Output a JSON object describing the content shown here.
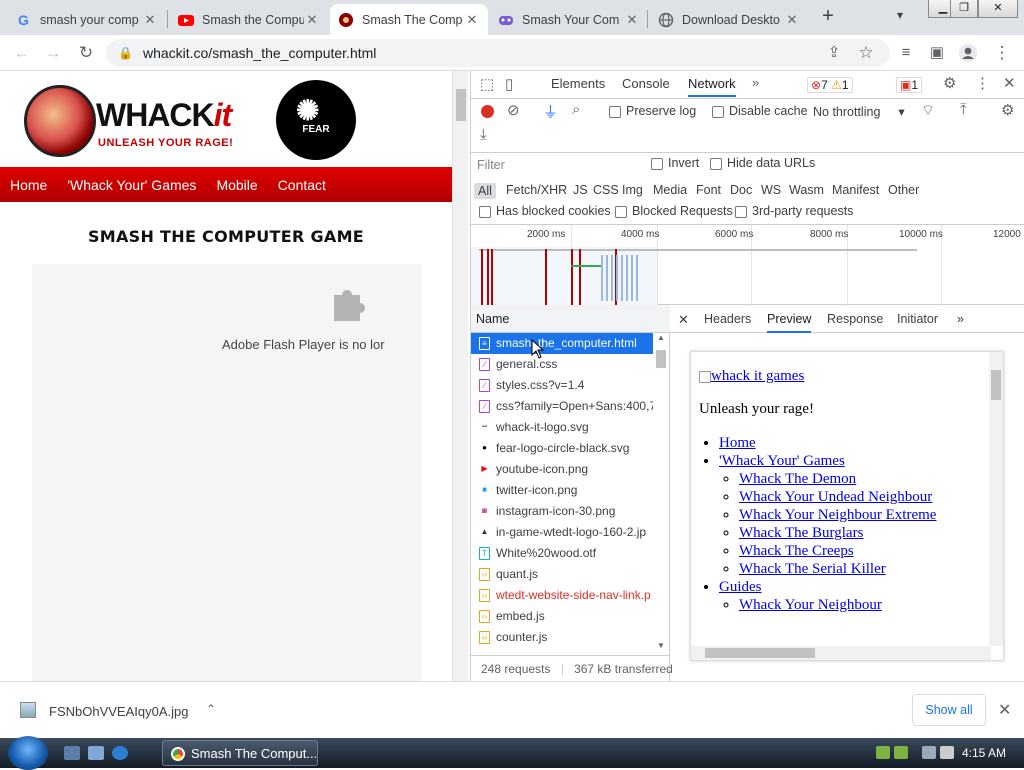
{
  "tabs": [
    {
      "title": "smash your comp",
      "icon": "google-icon",
      "active": false
    },
    {
      "title": "Smash the Compu",
      "icon": "youtube-icon",
      "active": false
    },
    {
      "title": "Smash The Comp",
      "icon": "whackit-icon",
      "active": true
    },
    {
      "title": "Smash Your Com",
      "icon": "gamepad-icon",
      "active": false
    },
    {
      "title": "Download Deskto",
      "icon": "globe-icon",
      "active": false
    }
  ],
  "omnibox": {
    "url": "whackit.co/smash_the_computer.html"
  },
  "site": {
    "logo_word": "WHACK",
    "logo_it": "it",
    "tagline": "UNLEASH YOUR RAGE!",
    "fear_label": "FEAR",
    "nav": [
      "Home",
      "'Whack Your' Games",
      "Mobile",
      "Contact"
    ],
    "game_title": "SMASH THE COMPUTER GAME",
    "flash_message": "Adobe Flash Player is no lor"
  },
  "devtools": {
    "tabs": [
      "Elements",
      "Console",
      "Network"
    ],
    "active_tab": "Network",
    "errors": "7",
    "warnings": "1",
    "issues": "1",
    "preserve_log": "Preserve log",
    "disable_cache": "Disable cache",
    "throttling": "No throttling",
    "filter_placeholder": "Filter",
    "invert": "Invert",
    "hide_data_urls": "Hide data URLs",
    "types": [
      "All",
      "Fetch/XHR",
      "JS",
      "CSS",
      "Img",
      "Media",
      "Font",
      "Doc",
      "WS",
      "Wasm",
      "Manifest",
      "Other"
    ],
    "has_blocked_cookies": "Has blocked cookies",
    "blocked_requests": "Blocked Requests",
    "third_party": "3rd-party requests",
    "timeline_ticks": [
      "2000 ms",
      "4000 ms",
      "6000 ms",
      "8000 ms",
      "10000 ms",
      "12000"
    ],
    "name_header": "Name",
    "requests": [
      {
        "name": "smash_the_computer.html",
        "kind": "doc",
        "selected": true
      },
      {
        "name": "general.css",
        "kind": "css"
      },
      {
        "name": "styles.css?v=1.4",
        "kind": "css"
      },
      {
        "name": "css?family=Open+Sans:400,70",
        "kind": "css"
      },
      {
        "name": "whack-it-logo.svg",
        "kind": "img"
      },
      {
        "name": "fear-logo-circle-black.svg",
        "kind": "img"
      },
      {
        "name": "youtube-icon.png",
        "kind": "img"
      },
      {
        "name": "twitter-icon.png",
        "kind": "img"
      },
      {
        "name": "instagram-icon-30.png",
        "kind": "img"
      },
      {
        "name": "in-game-wtedt-logo-160-2.jp",
        "kind": "img"
      },
      {
        "name": "White%20wood.otf",
        "kind": "font"
      },
      {
        "name": "quant.js",
        "kind": "js"
      },
      {
        "name": "wtedt-website-side-nav-link.p",
        "kind": "img",
        "error": true
      },
      {
        "name": "embed.js",
        "kind": "js"
      },
      {
        "name": "counter.js",
        "kind": "js"
      }
    ],
    "summary_requests": "248 requests",
    "summary_transferred": "367 kB transferred",
    "preview_tabs": [
      "Headers",
      "Preview",
      "Response",
      "Initiator"
    ],
    "preview_active": "Preview",
    "preview": {
      "img_alt": "whack it games",
      "tagline": "Unleash your rage!",
      "home": "Home",
      "games": "'Whack Your' Games",
      "games_sub": [
        "Whack The Demon",
        "Whack Your Undead Neighbour",
        "Whack Your Neighbour Extreme",
        "Whack The Burglars",
        "Whack The Creeps",
        "Whack The Serial Killer"
      ],
      "guides": "Guides",
      "guides_sub": [
        "Whack Your Neighbour"
      ]
    }
  },
  "download": {
    "file": "FSNbOhVVEAIqy0A.jpg",
    "show_all": "Show all"
  },
  "taskbar": {
    "task": "Smash The Comput...",
    "clock": "4:15 AM"
  }
}
